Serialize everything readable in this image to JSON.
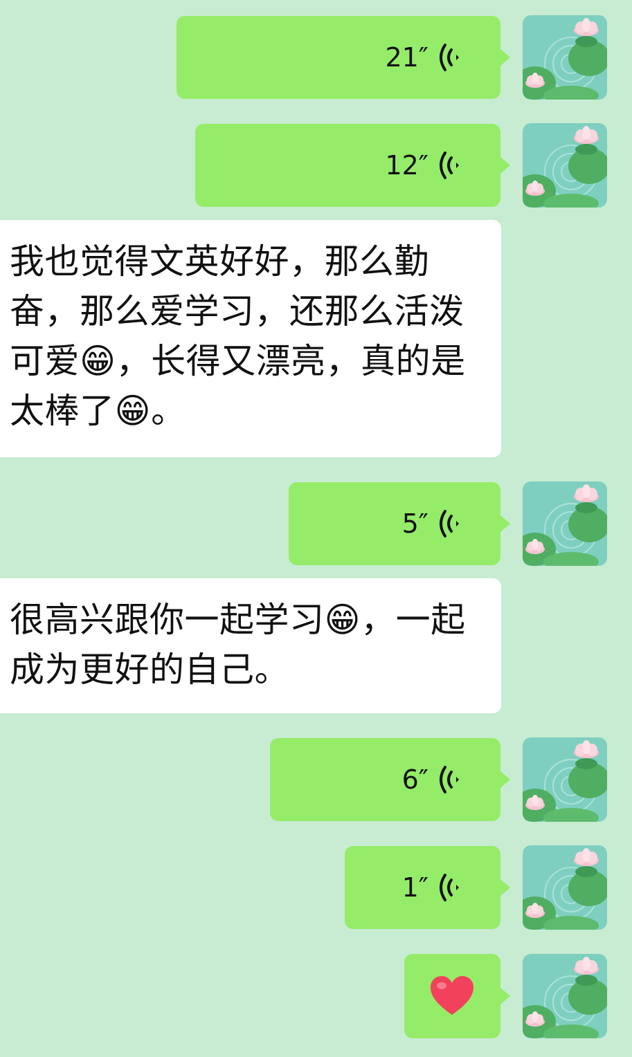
{
  "messages": [
    {
      "type": "voice",
      "duration": "21″"
    },
    {
      "type": "voice",
      "duration": "12″"
    },
    {
      "type": "text",
      "text": "我也觉得文英好好，那么勤奋，那么爱学习，还那么活泼可爱😁，长得又漂亮，真的是太棒了😁。"
    },
    {
      "type": "voice",
      "duration": "5″"
    },
    {
      "type": "text",
      "text": "很高兴跟你一起学习😁，一起成为更好的自己。"
    },
    {
      "type": "voice",
      "duration": "6″"
    },
    {
      "type": "voice",
      "duration": "1″"
    },
    {
      "type": "sticker",
      "emoji": "heart"
    }
  ],
  "colors": {
    "background": "#c8ecd2",
    "outgoing_bubble": "#95ec69",
    "incoming_bubble": "#ffffff"
  },
  "icons": {
    "voice": "voice-wave-icon",
    "avatar": "lotus-pond-avatar",
    "sticker": "red-heart-icon"
  }
}
